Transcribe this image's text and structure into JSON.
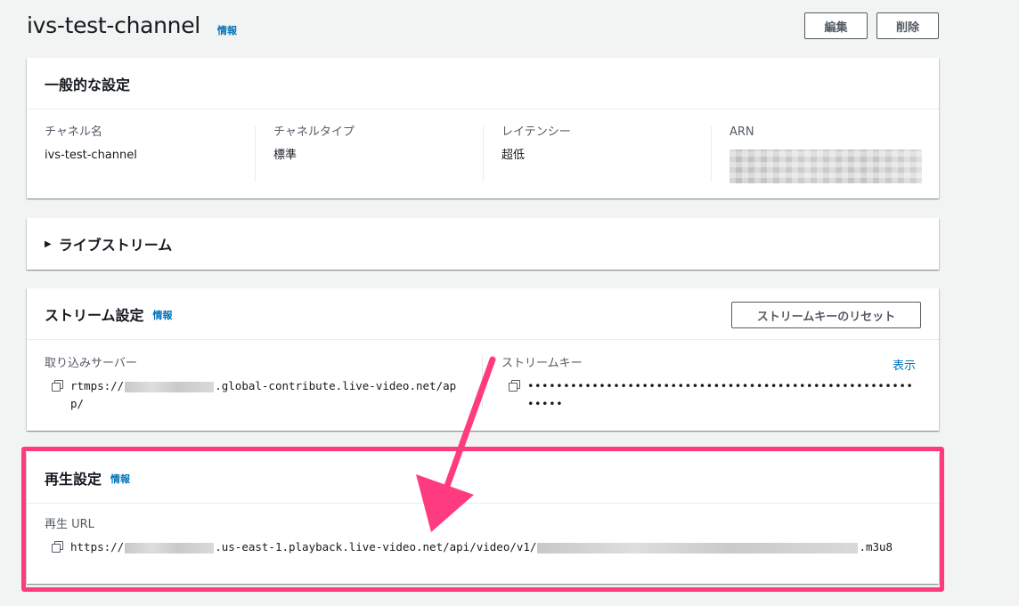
{
  "header": {
    "title": "ivs-test-channel",
    "info": "情報",
    "edit_label": "編集",
    "delete_label": "削除"
  },
  "general": {
    "title": "一般的な設定",
    "fields": [
      {
        "label": "チャネル名",
        "value": "ivs-test-channel"
      },
      {
        "label": "チャネルタイプ",
        "value": "標準"
      },
      {
        "label": "レイテンシー",
        "value": "超低"
      },
      {
        "label": "ARN",
        "value": ""
      }
    ]
  },
  "live": {
    "title": "ライブストリーム",
    "caret": "▶"
  },
  "stream": {
    "title": "ストリーム設定",
    "info": "情報",
    "reset_label": "ストリームキーのリセット",
    "ingest_label": "取り込みサーバー",
    "ingest_prefix": "rtmps://",
    "ingest_suffix": ".global-contribute.live-video.net/app/",
    "key_label": "ストリームキー",
    "key_show": "表示",
    "key_masked": "•••••••••••••••••••••••••••••••••••••••••••••••••••••••••••"
  },
  "playback": {
    "title": "再生設定",
    "info": "情報",
    "url_label": "再生 URL",
    "url_prefix": "https://",
    "url_middle": ".us-east-1.playback.live-video.net/api/video/v1/",
    "url_suffix": ".m3u8"
  },
  "colors": {
    "highlight": "#ff3b7f",
    "link": "#0073bb"
  }
}
